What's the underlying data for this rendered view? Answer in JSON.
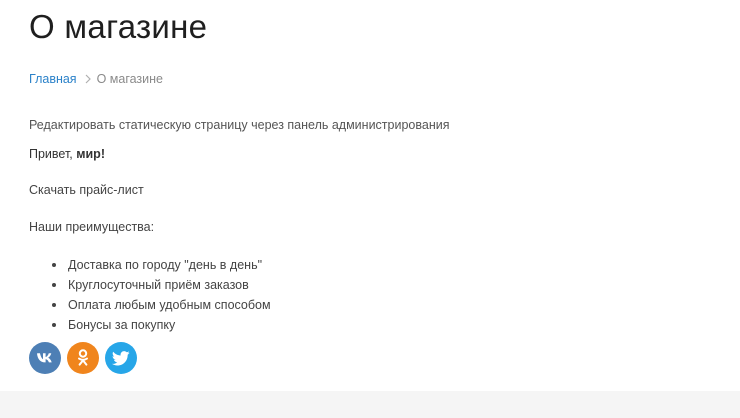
{
  "page": {
    "title": "О магазине"
  },
  "breadcrumb": {
    "home": "Главная",
    "current": "О магазине"
  },
  "content": {
    "admin_link": "Редактировать статическую страницу через панель администрирования",
    "greeting_prefix": "Привет, ",
    "greeting_bold": "мир!",
    "price_link": "Скачать прайс-лист",
    "advantages_title": "Наши преимущества:",
    "advantages": [
      "Доставка по городу \"день в день\"",
      "Круглосуточный приём заказов",
      "Оплата любым удобным способом",
      "Бонусы за покупку"
    ]
  },
  "social": {
    "colors": {
      "vk": "#4d7fb5",
      "ok": "#f0851d",
      "twitter": "#27a6e8"
    },
    "icons": [
      "vk-icon",
      "odnoklassniki-icon",
      "twitter-icon"
    ]
  }
}
